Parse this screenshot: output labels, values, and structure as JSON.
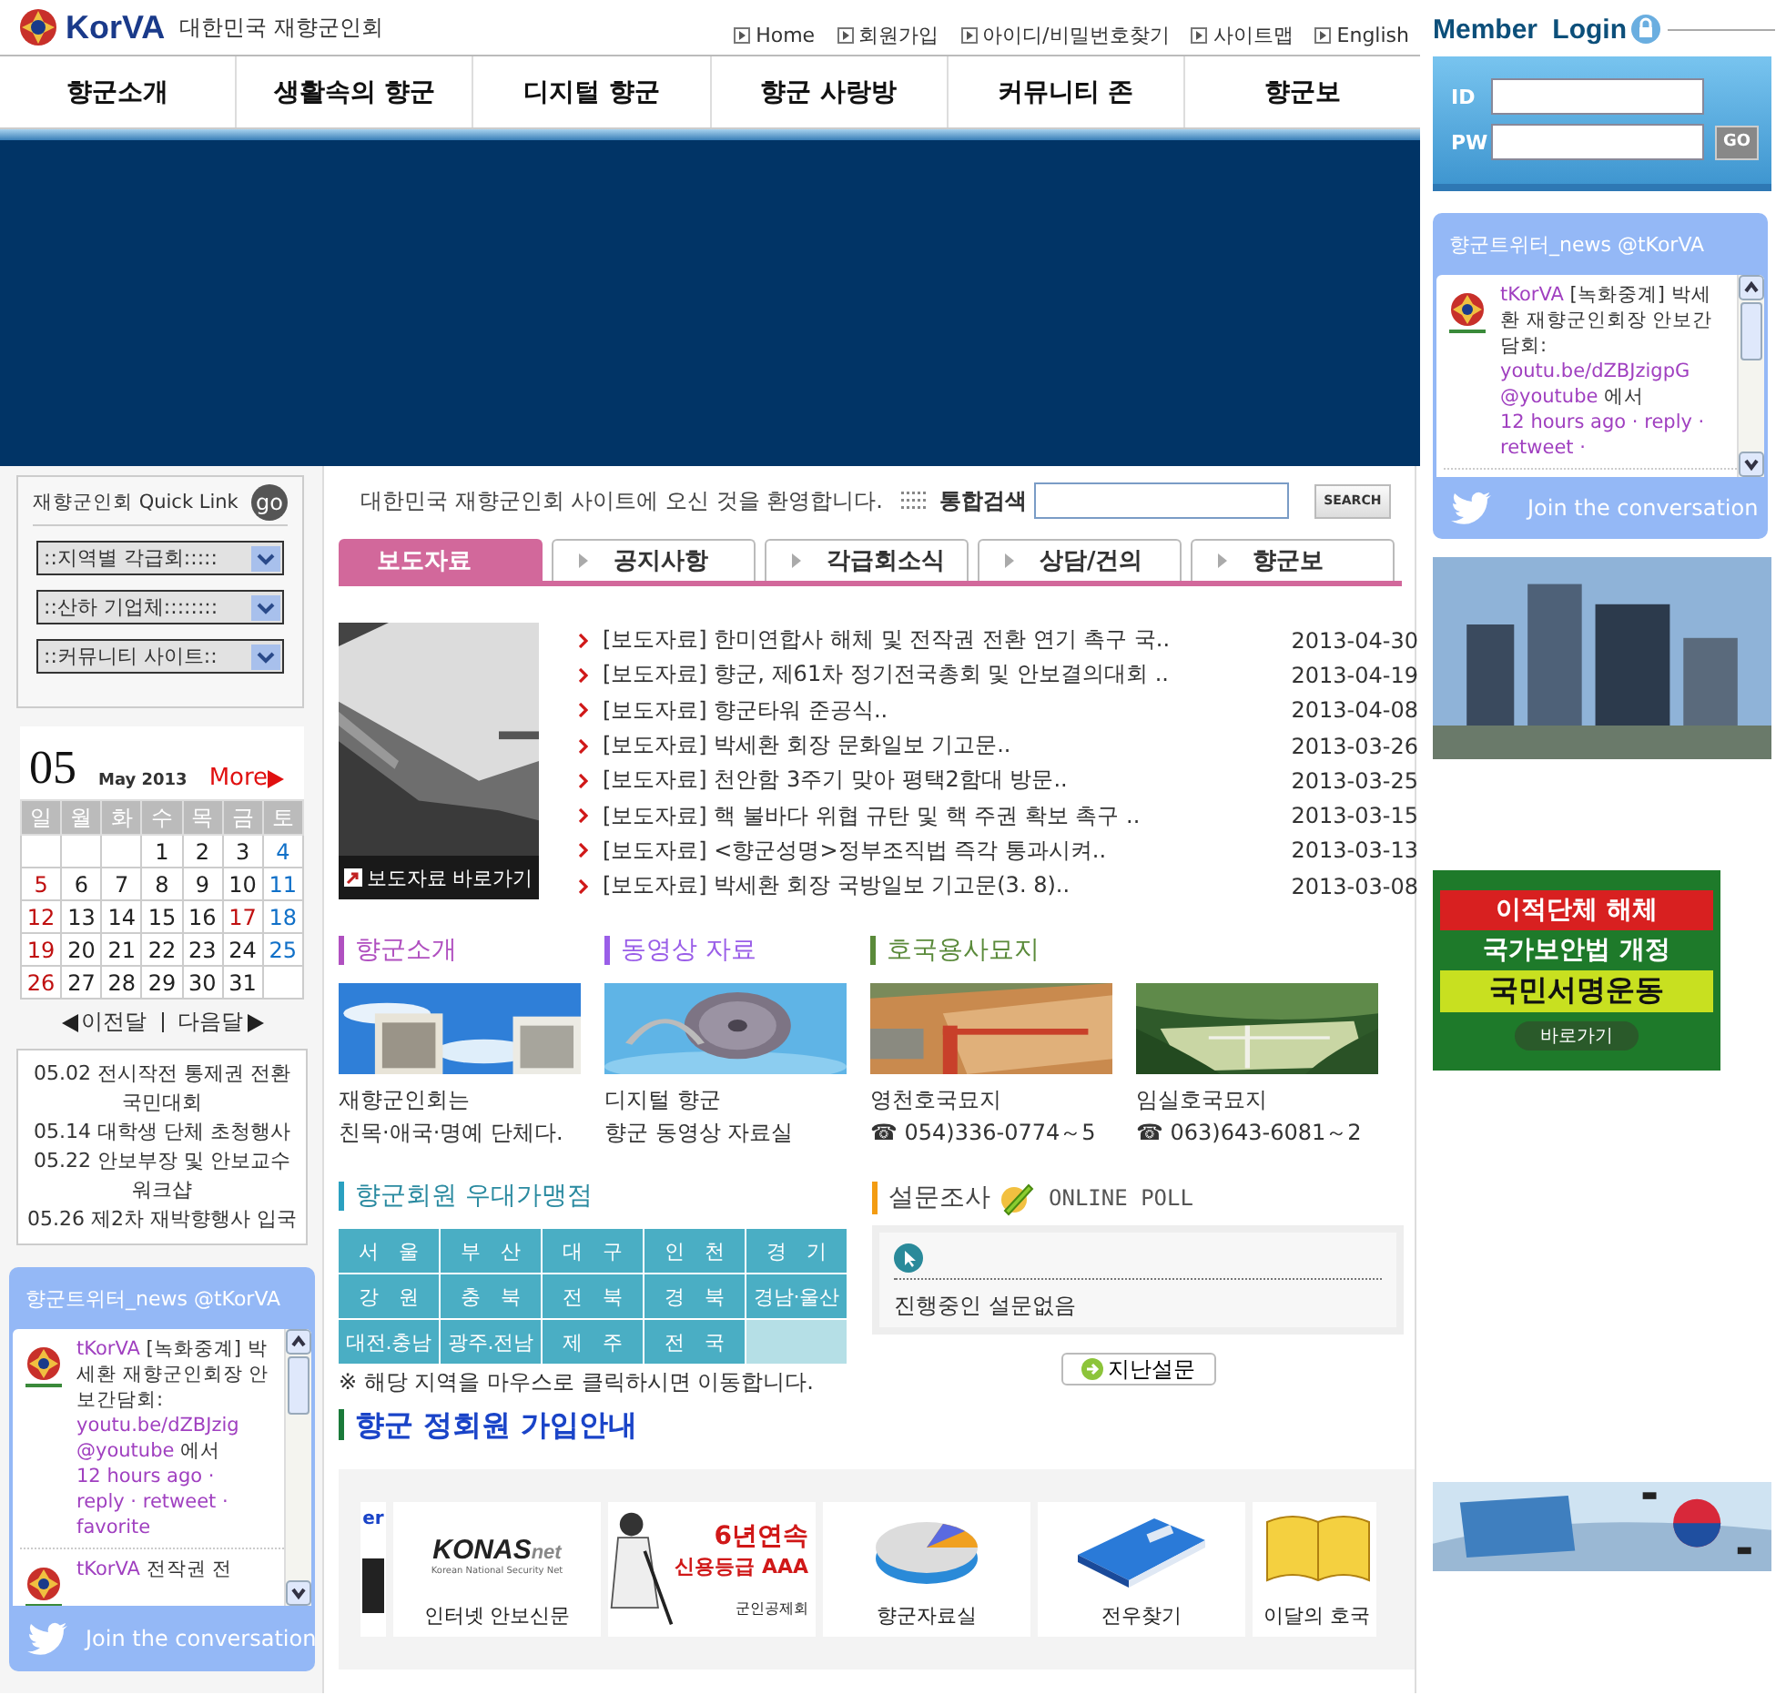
{
  "header": {
    "logo": "KorVA",
    "subtitle": "대한민국 재향군인회",
    "links": [
      "Home",
      "회원가입",
      "아이디/비밀번호찾기",
      "사이트맵",
      "English"
    ]
  },
  "nav": [
    "향군소개",
    "생활속의 향군",
    "디지털 향군",
    "향군 사랑방",
    "커뮤니티 존",
    "향군보"
  ],
  "quick_link": {
    "title": "재향군인회 Quick Link",
    "go": "go",
    "dropdowns": [
      "::지역별 각급회:::::",
      "::산하 기업체::::::::",
      "::커뮤니티 사이트::"
    ]
  },
  "calendar": {
    "day": "05",
    "month": "May 2013",
    "more": "More",
    "weekdays": [
      "일",
      "월",
      "화",
      "수",
      "목",
      "금",
      "토"
    ],
    "weeks": [
      [
        {
          "kind": "blank"
        },
        {
          "kind": "blank"
        },
        {
          "kind": "blank"
        },
        {
          "day": "1",
          "kind": "weekday"
        },
        {
          "day": "2",
          "kind": "weekday"
        },
        {
          "day": "3",
          "kind": "weekday"
        },
        {
          "day": "4",
          "kind": "saturday"
        }
      ],
      [
        {
          "day": "5",
          "kind": "sunday"
        },
        {
          "day": "6",
          "kind": "weekday"
        },
        {
          "day": "7",
          "kind": "weekday"
        },
        {
          "day": "8",
          "kind": "weekday"
        },
        {
          "day": "9",
          "kind": "weekday"
        },
        {
          "day": "10",
          "kind": "weekday"
        },
        {
          "day": "11",
          "kind": "saturday"
        }
      ],
      [
        {
          "day": "12",
          "kind": "sunday"
        },
        {
          "day": "13",
          "kind": "weekday"
        },
        {
          "day": "14",
          "kind": "weekday"
        },
        {
          "day": "15",
          "kind": "weekday"
        },
        {
          "day": "16",
          "kind": "weekday"
        },
        {
          "day": "17",
          "kind": "holiday"
        },
        {
          "day": "18",
          "kind": "saturday"
        }
      ],
      [
        {
          "day": "19",
          "kind": "sunday"
        },
        {
          "day": "20",
          "kind": "weekday"
        },
        {
          "day": "21",
          "kind": "weekday"
        },
        {
          "day": "22",
          "kind": "weekday"
        },
        {
          "day": "23",
          "kind": "weekday"
        },
        {
          "day": "24",
          "kind": "weekday"
        },
        {
          "day": "25",
          "kind": "saturday"
        }
      ],
      [
        {
          "day": "26",
          "kind": "sunday"
        },
        {
          "day": "27",
          "kind": "weekday"
        },
        {
          "day": "28",
          "kind": "weekday"
        },
        {
          "day": "29",
          "kind": "weekday"
        },
        {
          "day": "30",
          "kind": "weekday"
        },
        {
          "day": "31",
          "kind": "weekday"
        },
        {
          "kind": "blank"
        }
      ]
    ],
    "prev": "이전달",
    "next": "다음달"
  },
  "schedule": [
    "05.02 전시작전 통제권 전환 국민대회",
    "05.14 대학생 단체 초청행사",
    "05.22 안보부장 및 안보교수 워크샵",
    "05.26 제2차 재박향행사 입국"
  ],
  "left_twitter": {
    "title": "향군트위터_news @tKorVA",
    "tweets": [
      {
        "user": "tKorVA",
        "text": "[녹화중계] 박세환 재향군인회장 안보간담회:",
        "link": "youtu.be/dZBJzig",
        "via": "@youtube",
        "via_suffix": "에서",
        "actions": [
          "12 hours ago ·",
          "reply ·",
          "retweet ·",
          "favorite"
        ]
      },
      {
        "user": "tKorVA",
        "text": "전작권 전"
      }
    ],
    "footer": "Join the conversation"
  },
  "welcome": "대한민국 재향군인회 사이트에 오신 것을 환영합니다.",
  "search": {
    "label": "통합검색",
    "button": "SEARCH"
  },
  "tabs": [
    {
      "label": "보도자료",
      "selected": true
    },
    {
      "label": "공지사항",
      "selected": false
    },
    {
      "label": "각급회소식",
      "selected": false
    },
    {
      "label": "상담/건의",
      "selected": false
    },
    {
      "label": "향군보",
      "selected": false
    }
  ],
  "news_link": "보도자료 바로가기",
  "news": [
    {
      "title": "[보도자료] 한미연합사 해체 및 전작권 전환 연기 촉구 국..",
      "date": "2013-04-30"
    },
    {
      "title": "[보도자료] 향군, 제61차 정기전국총회 및 안보결의대회 ..",
      "date": "2013-04-19"
    },
    {
      "title": "[보도자료] 향군타워 준공식..",
      "date": "2013-04-08"
    },
    {
      "title": "[보도자료] 박세환 회장 문화일보 기고문..",
      "date": "2013-03-26"
    },
    {
      "title": "[보도자료] 천안함 3주기 맞아 평택2함대 방문..",
      "date": "2013-03-25"
    },
    {
      "title": "[보도자료] 핵 불바다 위협 규탄 및 핵 주권 확보 촉구 ..",
      "date": "2013-03-15"
    },
    {
      "title": "[보도자료] <향군성명>정부조직법 즉각 통과시켜..",
      "date": "2013-03-13"
    },
    {
      "title": "[보도자료] 박세환 회장 국방일보 기고문(3. 8)..",
      "date": "2013-03-08"
    }
  ],
  "sections": [
    {
      "title": "향군소개",
      "color": "#b050c0",
      "lines": [
        "재향군인회는",
        "친목·애국·명예 단체다."
      ]
    },
    {
      "title": "동영상 자료",
      "color": "#9a5ee8",
      "lines": [
        "디지털 향군",
        "향군 동영상 자료실"
      ]
    },
    {
      "title": "호국용사묘지",
      "color": "#5a8a3a",
      "cemeteries": [
        {
          "name": "영천호국묘지",
          "phone": "☎ 054)336-0774～5"
        },
        {
          "name": "임실호국묘지",
          "phone": "☎ 063)643-6081～2"
        }
      ]
    }
  ],
  "stores": {
    "title": "향군회원 우대가맹점",
    "regions": [
      {
        "kind": "region",
        "label": "서 울"
      },
      {
        "kind": "region",
        "label": "부 산"
      },
      {
        "kind": "region",
        "label": "대 구"
      },
      {
        "kind": "region",
        "label": "인 천"
      },
      {
        "kind": "region",
        "label": "경 기"
      },
      {
        "kind": "region",
        "label": "강 원"
      },
      {
        "kind": "region",
        "label": "충 북"
      },
      {
        "kind": "region",
        "label": "전 북"
      },
      {
        "kind": "region",
        "label": "경 북"
      },
      {
        "kind": "region",
        "label": "경남·울산"
      },
      {
        "kind": "region",
        "label": "대전.충남"
      },
      {
        "kind": "region",
        "label": "광주.전남"
      },
      {
        "kind": "region",
        "label": "제 주"
      },
      {
        "kind": "region",
        "label": "전 국"
      },
      {
        "kind": "empty"
      }
    ],
    "note": "※ 해당 지역을 마우스로 클릭하시면 이동합니다."
  },
  "poll": {
    "title": "설문조사",
    "subtitle": "ONLINE POLL",
    "message": "진행중인 설문없음",
    "button": "지난설문"
  },
  "join": "향군 정회원 가입안내",
  "strip": [
    {
      "kind": "partial",
      "text": "er"
    },
    {
      "kind": "konas",
      "logo": "KONAS",
      "logo_suffix": "net",
      "tagline": "Korean National Security Net",
      "caption": "인터넷 안보신문"
    },
    {
      "kind": "ad",
      "headline": "6년연속",
      "subline": "신용등급 AAA",
      "brand": "군인공제회"
    },
    {
      "kind": "chart_tile",
      "caption": "향군자료실"
    },
    {
      "kind": "book_tile",
      "caption": "전우찾기"
    },
    {
      "kind": "open_book_tile",
      "caption": "이달의 호국"
    }
  ],
  "login": {
    "title": "Member Login",
    "id_label": "ID",
    "pw_label": "PW",
    "button": "GO"
  },
  "right_twitter": {
    "title": "향군트위터_news @tKorVA",
    "tweets": [
      {
        "user": "tKorVA",
        "text": "[녹화중계] 박세환 재향군인회장 안보간담회:",
        "link": "youtu.be/dZBJzigpG",
        "via": "@youtube",
        "via_suffix": "에서",
        "actions": [
          "12 hours ago ·",
          "reply ·",
          "retweet ·"
        ]
      }
    ],
    "footer": "Join the conversation"
  },
  "campaign": {
    "lines": [
      "이적단체 해체",
      "국가보안법 개정",
      "국민서명운동"
    ],
    "button": "바로가기"
  }
}
